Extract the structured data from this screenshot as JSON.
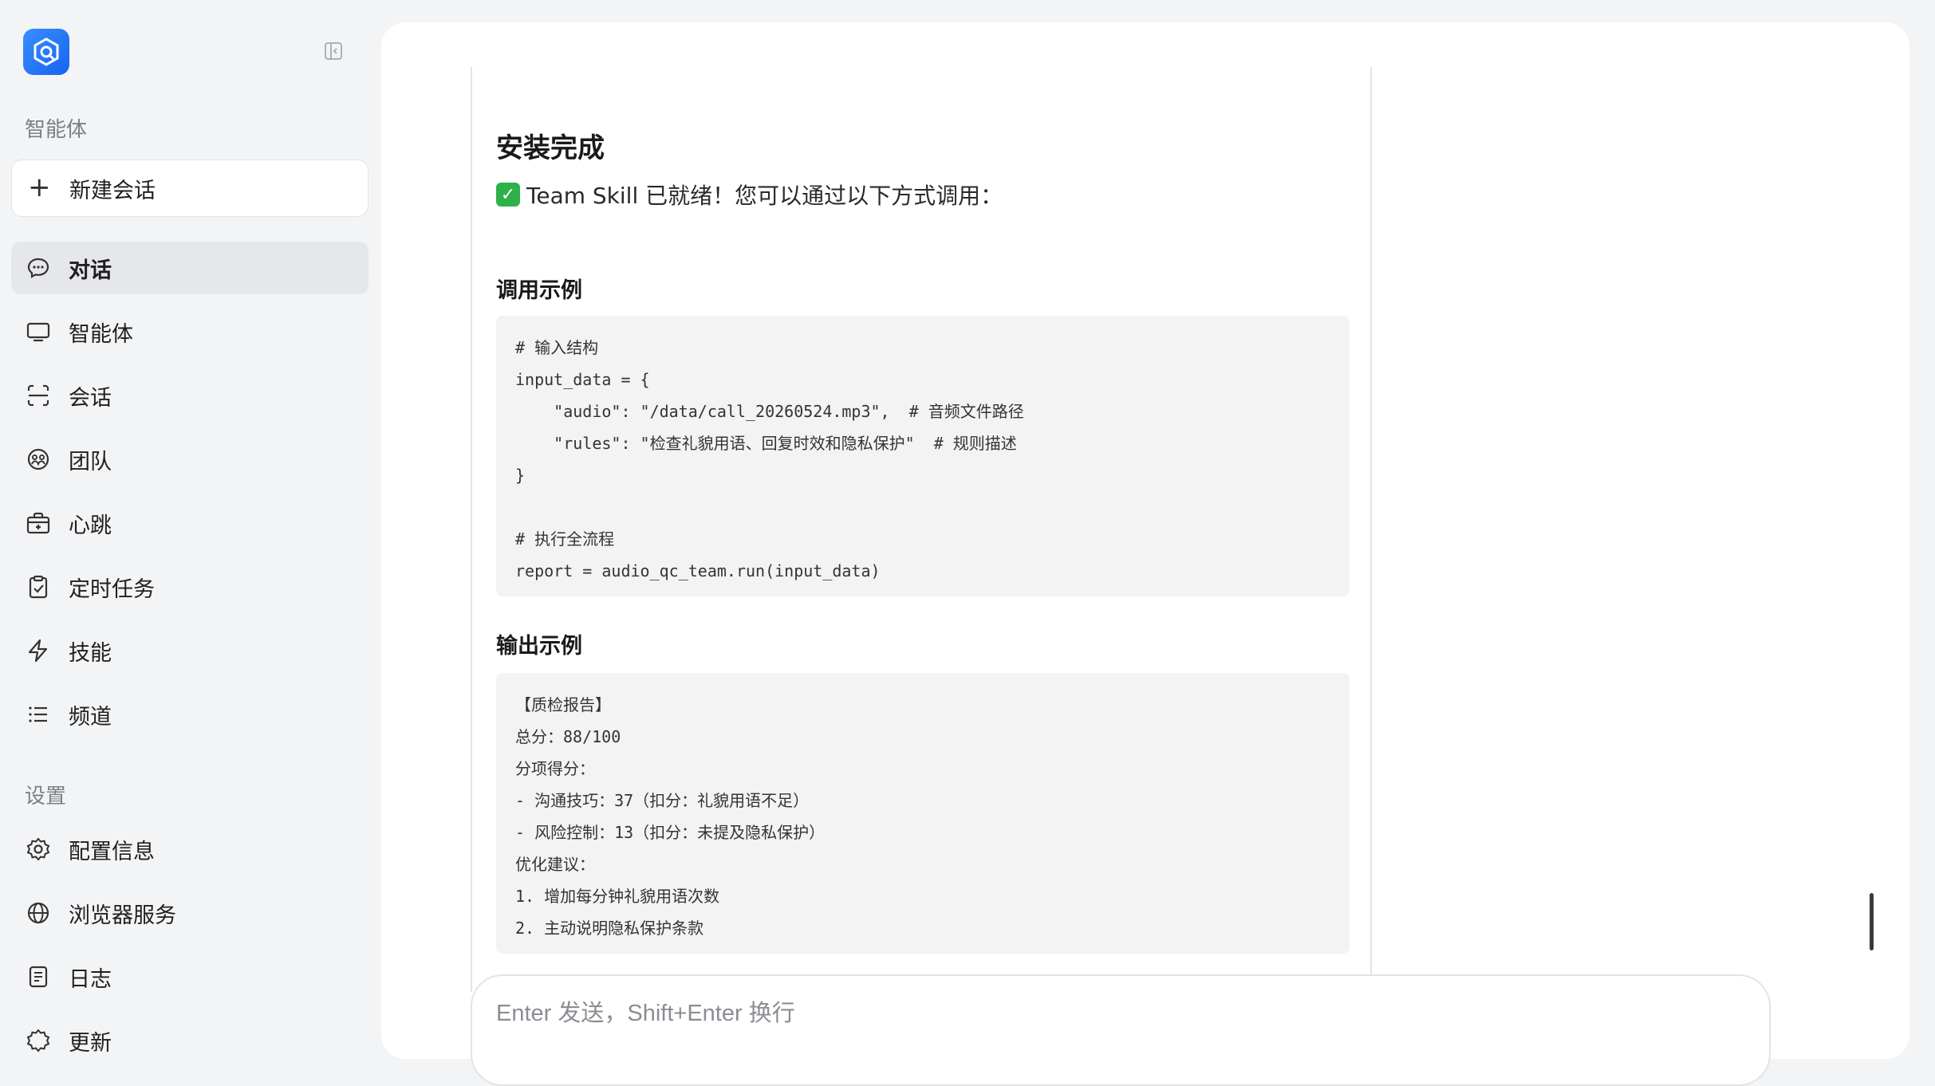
{
  "sidebar": {
    "section_agent": "智能体",
    "new_chat_label": "新建会话",
    "nav": [
      {
        "label": "对话",
        "icon": "chat-bubble-icon",
        "active": true
      },
      {
        "label": "智能体",
        "icon": "monitor-icon"
      },
      {
        "label": "会话",
        "icon": "session-icon"
      },
      {
        "label": "团队",
        "icon": "team-icon"
      },
      {
        "label": "心跳",
        "icon": "heartbeat-icon"
      },
      {
        "label": "定时任务",
        "icon": "clipboard-check-icon"
      },
      {
        "label": "技能",
        "icon": "lightning-icon"
      },
      {
        "label": "频道",
        "icon": "list-icon"
      }
    ],
    "section_settings": "设置",
    "settings": [
      {
        "label": "配置信息",
        "icon": "gear-icon"
      },
      {
        "label": "浏览器服务",
        "icon": "globe-icon"
      },
      {
        "label": "日志",
        "icon": "log-icon"
      },
      {
        "label": "更新",
        "icon": "update-icon"
      }
    ]
  },
  "message": {
    "heading": "安装完成",
    "lead_text": "Team Skill 已就绪！您可以通过以下方式调用：",
    "section_call": "调用示例",
    "code_call": [
      "# 输入结构",
      "input_data = {",
      "    \"audio\": \"/data/call_20260524.mp3\",  # 音频文件路径",
      "    \"rules\": \"检查礼貌用语、回复时效和隐私保护\"  # 规则描述",
      "}",
      "",
      "# 执行全流程",
      "report = audio_qc_team.run(input_data)"
    ],
    "section_output": "输出示例",
    "code_output": [
      "【质检报告】",
      "总分：88/100",
      "分项得分：",
      "- 沟通技巧：37（扣分：礼貌用语不足）",
      "- 风险控制：13（扣分：未提及隐私保护）",
      "优化建议：",
      "1. 增加每分钟礼貌用语次数",
      "2. 主动说明隐私保护条款"
    ]
  },
  "input": {
    "placeholder": "Enter 发送，Shift+Enter 换行"
  },
  "colors": {
    "brand": "#1f6ff5",
    "success": "#2fb14a"
  }
}
